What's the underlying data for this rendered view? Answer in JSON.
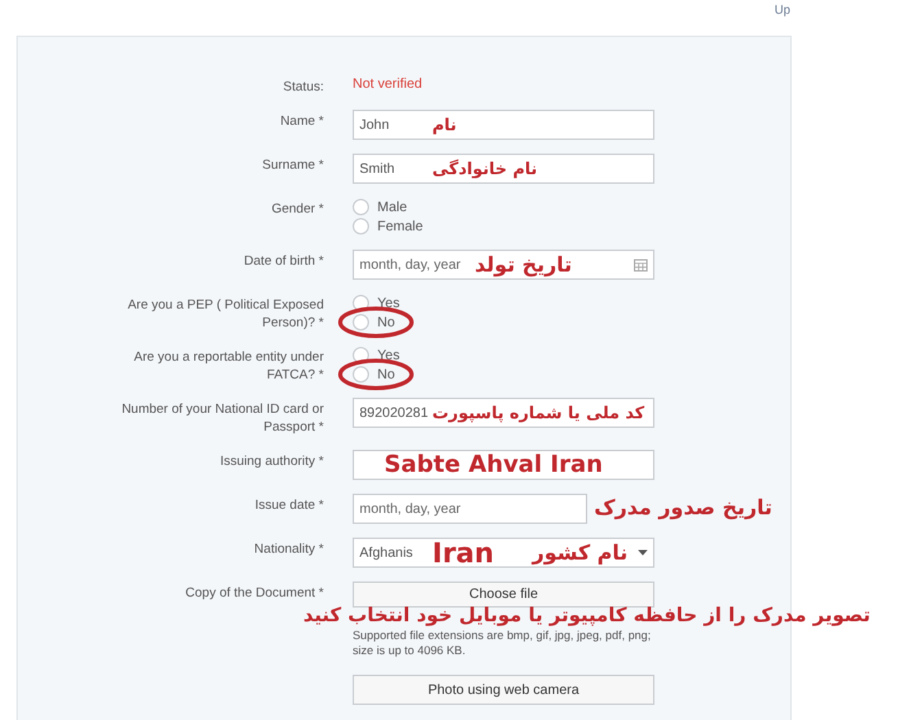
{
  "top_link": "Up",
  "fields": [
    {
      "kind": "status",
      "label": "Status:",
      "value": "Not verified"
    },
    {
      "kind": "text",
      "label": "Name *",
      "value": "John",
      "annotations": [
        "نام"
      ]
    },
    {
      "kind": "text",
      "label": "Surname *",
      "value": "Smith",
      "annotations": [
        "نام خانوادگی"
      ]
    },
    {
      "kind": "radio",
      "label": "Gender *",
      "options": [
        {
          "label": "Male",
          "selected": false,
          "highlighted": false
        },
        {
          "label": "Female",
          "selected": false,
          "highlighted": false
        }
      ]
    },
    {
      "kind": "date",
      "label": "Date of birth *",
      "placeholder": "month, day, year",
      "annotations": [
        "تاریخ تولد"
      ]
    },
    {
      "kind": "radio",
      "label": "Are you a PEP ( Political Exposed Person)? *",
      "options": [
        {
          "label": "Yes",
          "selected": false,
          "highlighted": false
        },
        {
          "label": "No",
          "selected": false,
          "highlighted": true
        }
      ]
    },
    {
      "kind": "radio",
      "label": "Are you a reportable entity under FATCA? *",
      "options": [
        {
          "label": "Yes",
          "selected": false,
          "highlighted": false
        },
        {
          "label": "No",
          "selected": false,
          "highlighted": true
        }
      ]
    },
    {
      "kind": "text",
      "label": "Number of your National ID card or Passport *",
      "value": "892020281",
      "annotations": [
        "کد ملی یا شماره پاسپورت"
      ]
    },
    {
      "kind": "text",
      "label": "Issuing authority *",
      "annotations": [
        "Sabte Ahval Iran"
      ]
    },
    {
      "kind": "shortdate",
      "label": "Issue date *",
      "placeholder": "month, day, year",
      "annotations": [
        "تاریخ صدور مدرک"
      ]
    },
    {
      "kind": "select",
      "label": "Nationality *",
      "value": "Afghanis",
      "annotations": [
        "Iran",
        "نام کشور"
      ]
    },
    {
      "kind": "file",
      "label": "Copy of the Document *",
      "button": "Choose file",
      "annotations": [
        "تصویر مدرک را از  حافظه کامپیوتر یا موبایل خود انتخاب کنید"
      ],
      "hint": "Supported file extensions are bmp, gif, jpg, jpeg, pdf, png; size is up to 4096 KB.",
      "camera_button": "Photo using web camera"
    }
  ]
}
